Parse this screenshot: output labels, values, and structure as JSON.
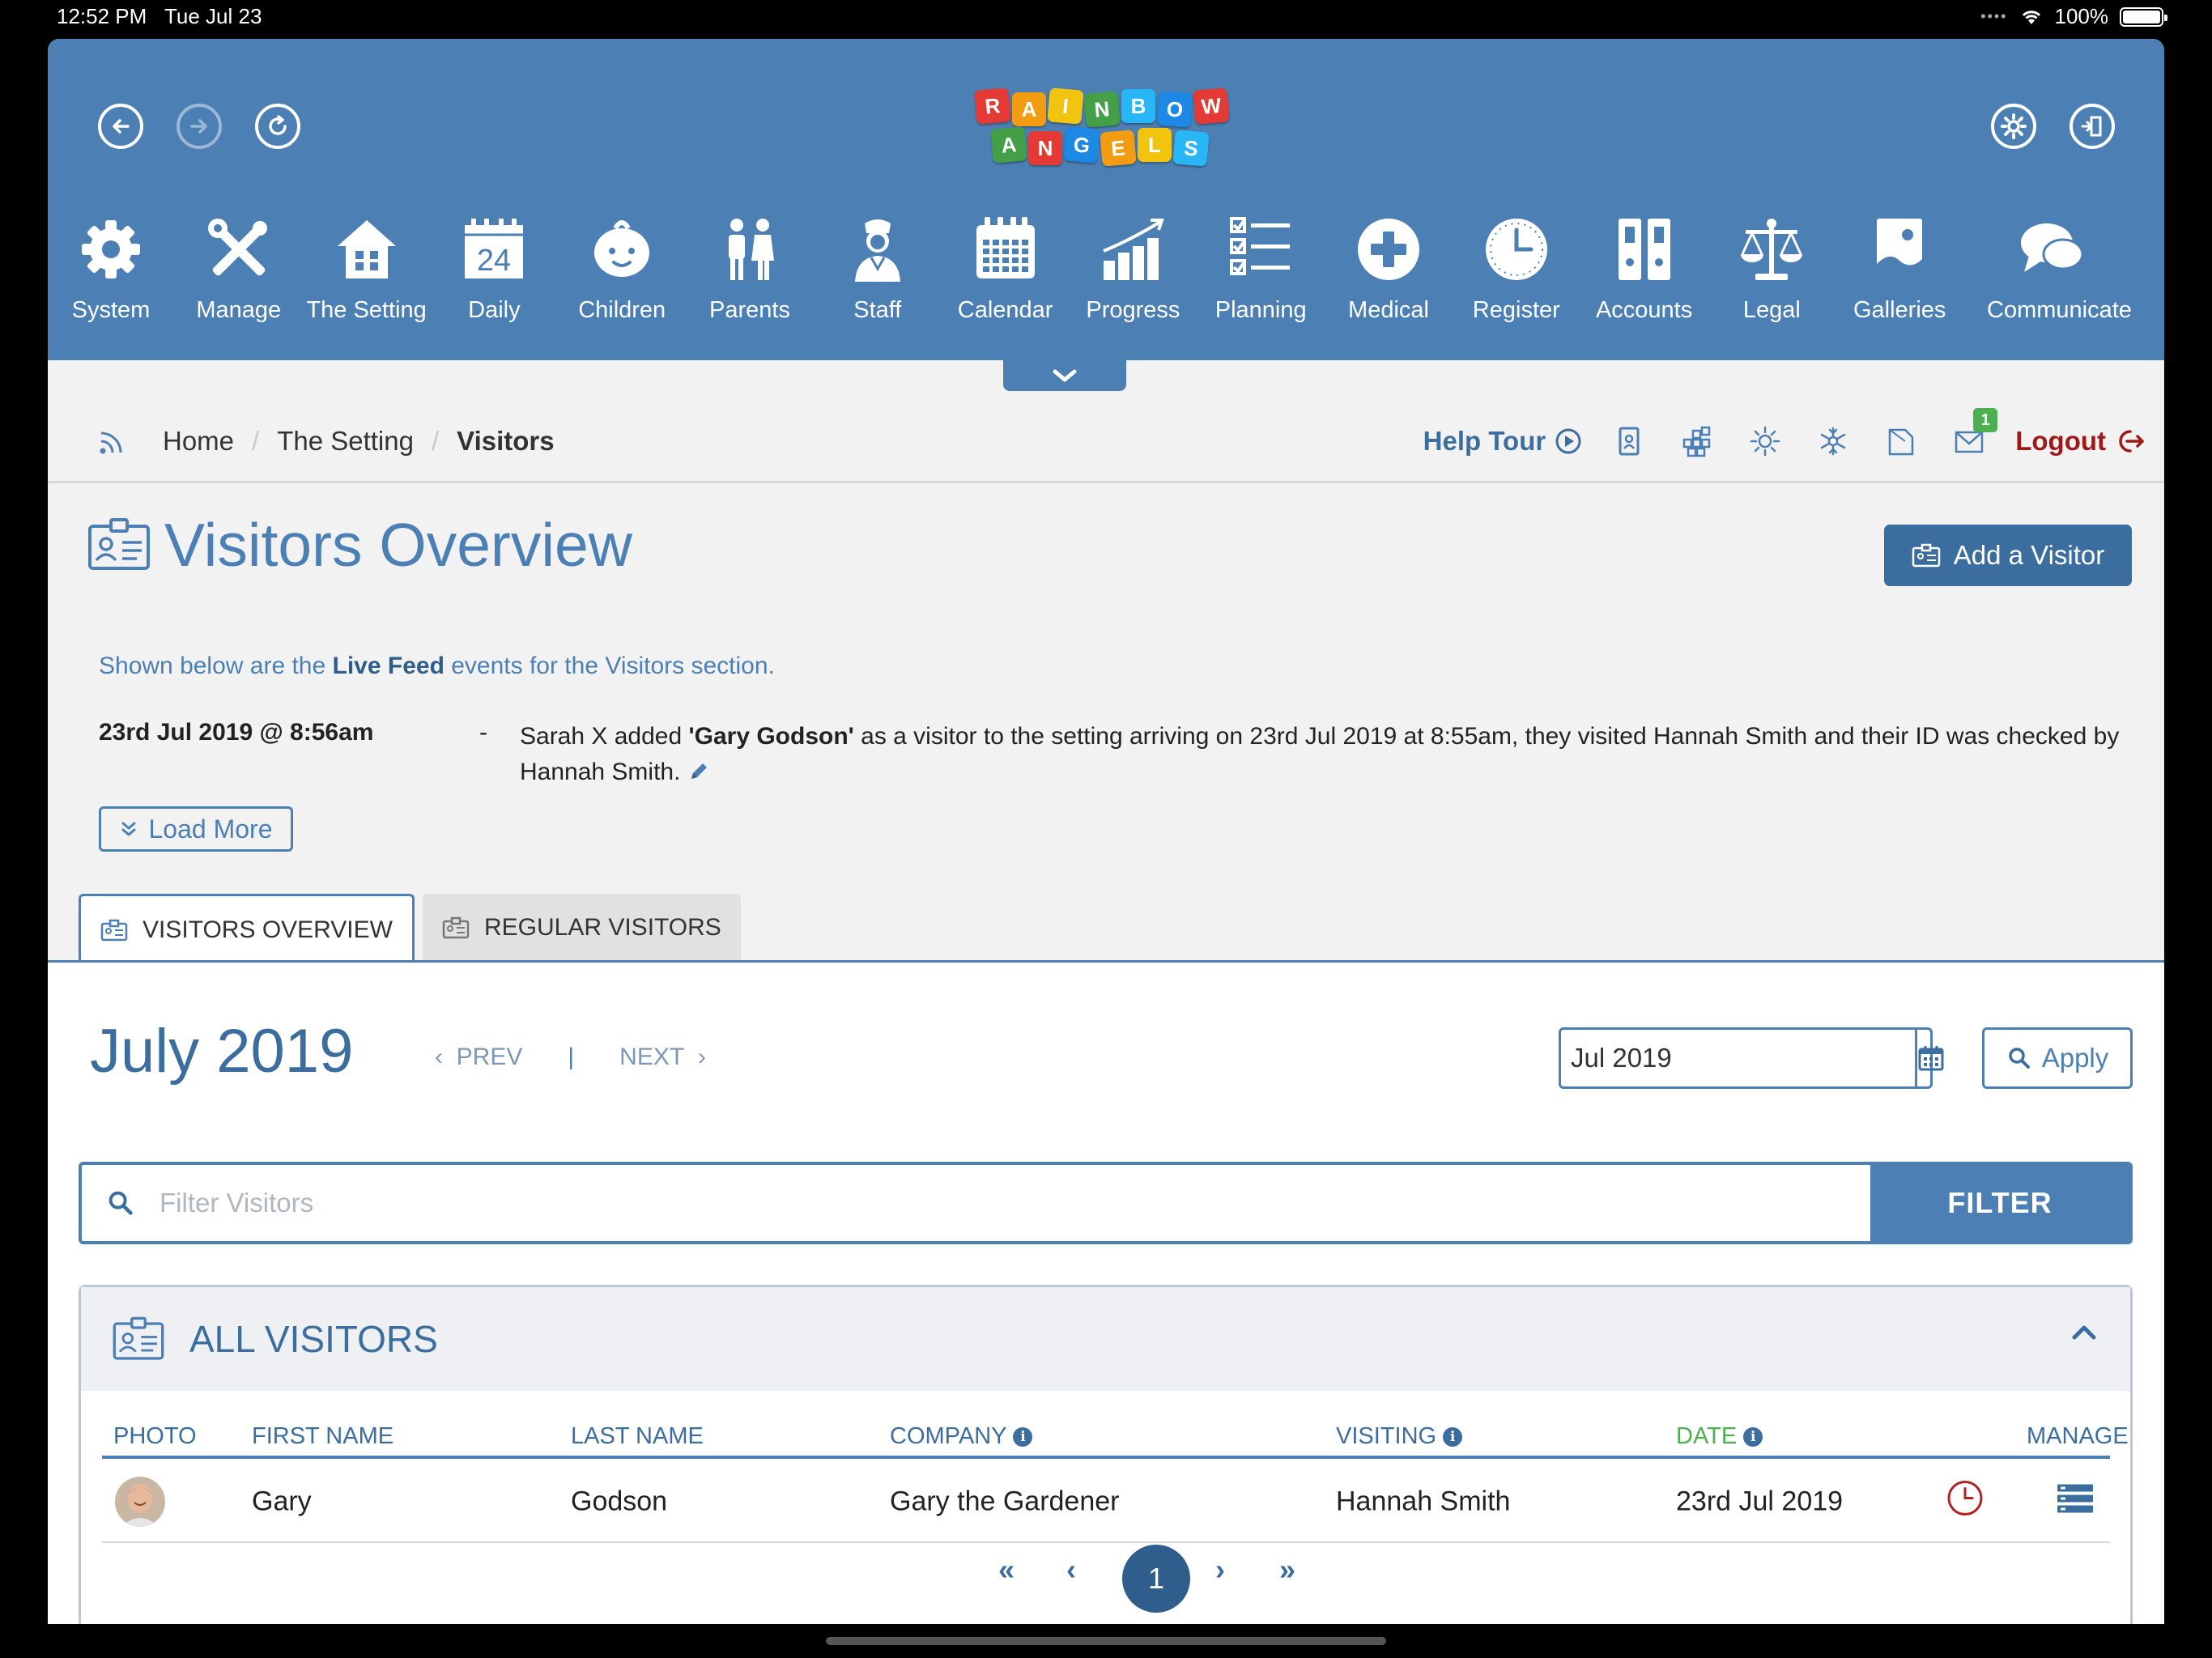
{
  "status": {
    "time": "12:52 PM",
    "date": "Tue Jul 23",
    "battery": "100%"
  },
  "logo": {
    "row1": [
      {
        "l": "R",
        "c": "#e53935"
      },
      {
        "l": "A",
        "c": "#f39c12"
      },
      {
        "l": "I",
        "c": "#f1c40f"
      },
      {
        "l": "N",
        "c": "#43a047"
      },
      {
        "l": "B",
        "c": "#29b6f6"
      },
      {
        "l": "O",
        "c": "#1e88e5"
      },
      {
        "l": "W",
        "c": "#e53935"
      }
    ],
    "row2": [
      {
        "l": "A",
        "c": "#43a047"
      },
      {
        "l": "N",
        "c": "#e53935"
      },
      {
        "l": "G",
        "c": "#1e88e5"
      },
      {
        "l": "E",
        "c": "#f39c12"
      },
      {
        "l": "L",
        "c": "#f1c40f"
      },
      {
        "l": "S",
        "c": "#29b6f6"
      }
    ]
  },
  "nav": [
    {
      "label": "System",
      "icon": "gear-icon"
    },
    {
      "label": "Manage",
      "icon": "tools-icon"
    },
    {
      "label": "The Setting",
      "icon": "house-icon"
    },
    {
      "label": "Daily",
      "icon": "calendar-day-icon",
      "day": "24"
    },
    {
      "label": "Children",
      "icon": "baby-icon"
    },
    {
      "label": "Parents",
      "icon": "parents-icon"
    },
    {
      "label": "Staff",
      "icon": "staff-icon"
    },
    {
      "label": "Calendar",
      "icon": "calendar-icon"
    },
    {
      "label": "Progress",
      "icon": "chart-icon"
    },
    {
      "label": "Planning",
      "icon": "checklist-icon"
    },
    {
      "label": "Medical",
      "icon": "medical-cross-icon"
    },
    {
      "label": "Register",
      "icon": "clock-icon"
    },
    {
      "label": "Accounts",
      "icon": "binders-icon"
    },
    {
      "label": "Legal",
      "icon": "scales-icon"
    },
    {
      "label": "Galleries",
      "icon": "picture-icon"
    },
    {
      "label": "Communicate",
      "icon": "speech-bubbles-icon"
    }
  ],
  "breadcrumb": {
    "home": "Home",
    "setting": "The Setting",
    "current": "Visitors"
  },
  "tools": {
    "help_tour": "Help Tour",
    "badge_count": "1",
    "logout": "Logout"
  },
  "page": {
    "title": "Visitors Overview",
    "add_button": "Add a Visitor",
    "intro_pre": "Shown below are the ",
    "intro_bold": "Live Feed",
    "intro_post": " events for the Visitors section.",
    "feed": {
      "when": "23rd Jul 2019 @ 8:56am",
      "dash": "-",
      "pre": "Sarah X added ",
      "bold": "'Gary Godson'",
      "post": " as a visitor to the setting arriving on 23rd Jul 2019 at 8:55am, they visited Hannah Smith and their ID was checked by Hannah Smith."
    },
    "load_more": "Load More"
  },
  "tabs": {
    "overview": "VISITORS OVERVIEW",
    "regular": "REGULAR VISITORS"
  },
  "month": {
    "title": "July 2019",
    "prev": "PREV",
    "next": "NEXT",
    "date_value": "Jul 2019",
    "apply": "Apply"
  },
  "filter": {
    "placeholder": "Filter Visitors",
    "button": "FILTER"
  },
  "table": {
    "title": "ALL VISITORS",
    "headers": {
      "photo": "PHOTO",
      "first": "FIRST NAME",
      "last": "LAST NAME",
      "company": "COMPANY",
      "visiting": "VISITING",
      "date": "DATE",
      "manage": "MANAGE"
    },
    "rows": [
      {
        "first": "Gary",
        "last": "Godson",
        "company": "Gary the Gardener",
        "visiting": "Hannah Smith",
        "date": "23rd Jul 2019"
      }
    ]
  },
  "pagination": {
    "first": "«",
    "prev": "‹",
    "current": "1",
    "next": "›",
    "last": "»"
  }
}
